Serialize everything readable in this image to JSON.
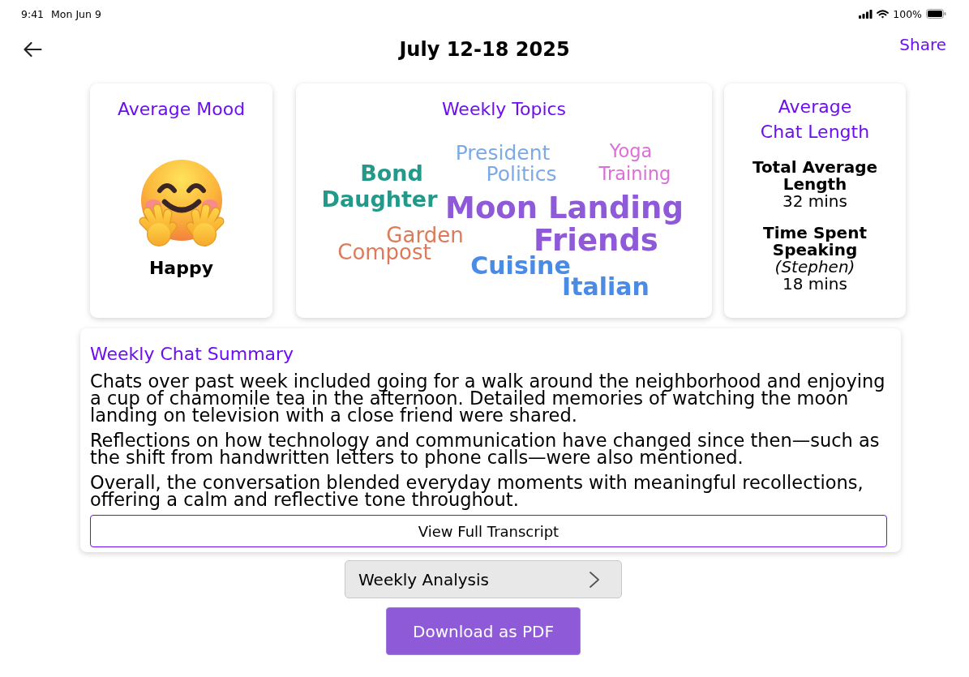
{
  "status_bar": {
    "time": "9:41",
    "date": "Mon Jun 9",
    "battery": "100%"
  },
  "header": {
    "title": "July 12-18 2025",
    "share": "Share"
  },
  "mood_card": {
    "title": "Average Mood",
    "mood": "Happy"
  },
  "topics_card": {
    "title": "Weekly Topics",
    "topics": [
      {
        "words": [
          "Bond",
          "Daughter"
        ],
        "color": "#23998a"
      },
      {
        "words": [
          "President",
          "Politics"
        ],
        "color": "#7caae6"
      },
      {
        "words": [
          "Yoga",
          "Training"
        ],
        "color": "#dc6fd6"
      },
      {
        "words": [
          "Moon Landing",
          "Friends"
        ],
        "color": "#8e5ad8"
      },
      {
        "words": [
          "Garden",
          "Compost"
        ],
        "color": "#dd7a5a"
      },
      {
        "words": [
          "Cuisine",
          "Italian"
        ],
        "color": "#4a8be6"
      }
    ]
  },
  "length_card": {
    "title": "Average Chat Length",
    "stats": [
      {
        "label": "Total Average Length",
        "value": "32 mins"
      },
      {
        "label": "Time Spent Speaking",
        "person": "(Stephen)",
        "value": "18 mins"
      }
    ]
  },
  "summary": {
    "title": "Weekly Chat Summary",
    "paragraphs": [
      "Chats over past week included going for a walk around the neighborhood and enjoying a cup of chamomile tea in the afternoon. Detailed memories of watching the moon landing on television with a close friend were shared.",
      "Reflections on how technology and communication have changed since then—such as the shift from handwritten letters to phone calls—were also mentioned.",
      "Overall, the conversation blended everyday moments with meaningful recollections, offering a calm and reflective tone throughout."
    ],
    "button": "View Full Transcript"
  },
  "weekly_analysis": {
    "label": "Weekly Analysis"
  },
  "download": {
    "label": "Download as PDF"
  }
}
